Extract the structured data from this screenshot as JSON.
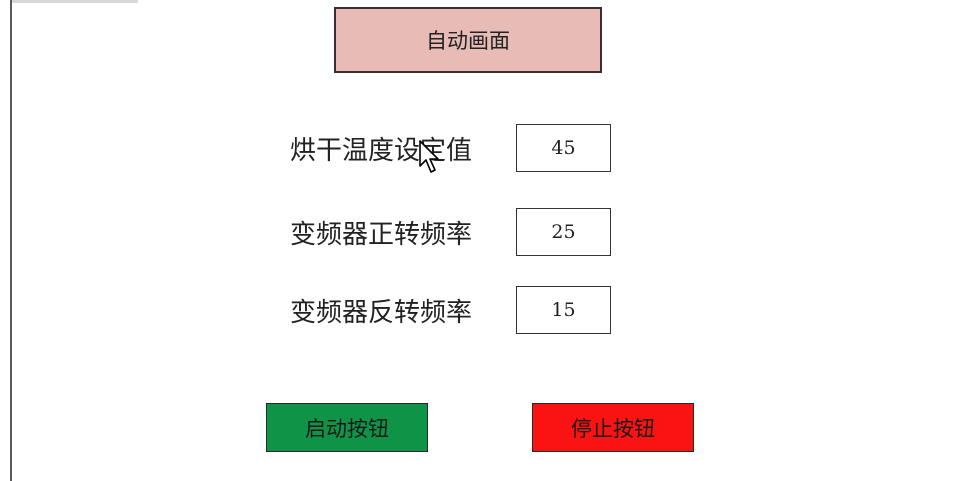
{
  "screen": {
    "title": "自动画面"
  },
  "parameters": [
    {
      "label": "烘干温度设定值",
      "value": "45"
    },
    {
      "label": "变频器正转频率",
      "value": "25"
    },
    {
      "label": "变频器反转频率",
      "value": "15"
    }
  ],
  "buttons": {
    "start": {
      "label": "启动按钮",
      "color": "#0f9447"
    },
    "stop": {
      "label": "停止按钮",
      "color": "#fb1212"
    }
  },
  "colors": {
    "title_bg": "#e8bbb6",
    "border": "#333333"
  },
  "icons": {
    "cursor": "mouse-pointer-icon"
  }
}
